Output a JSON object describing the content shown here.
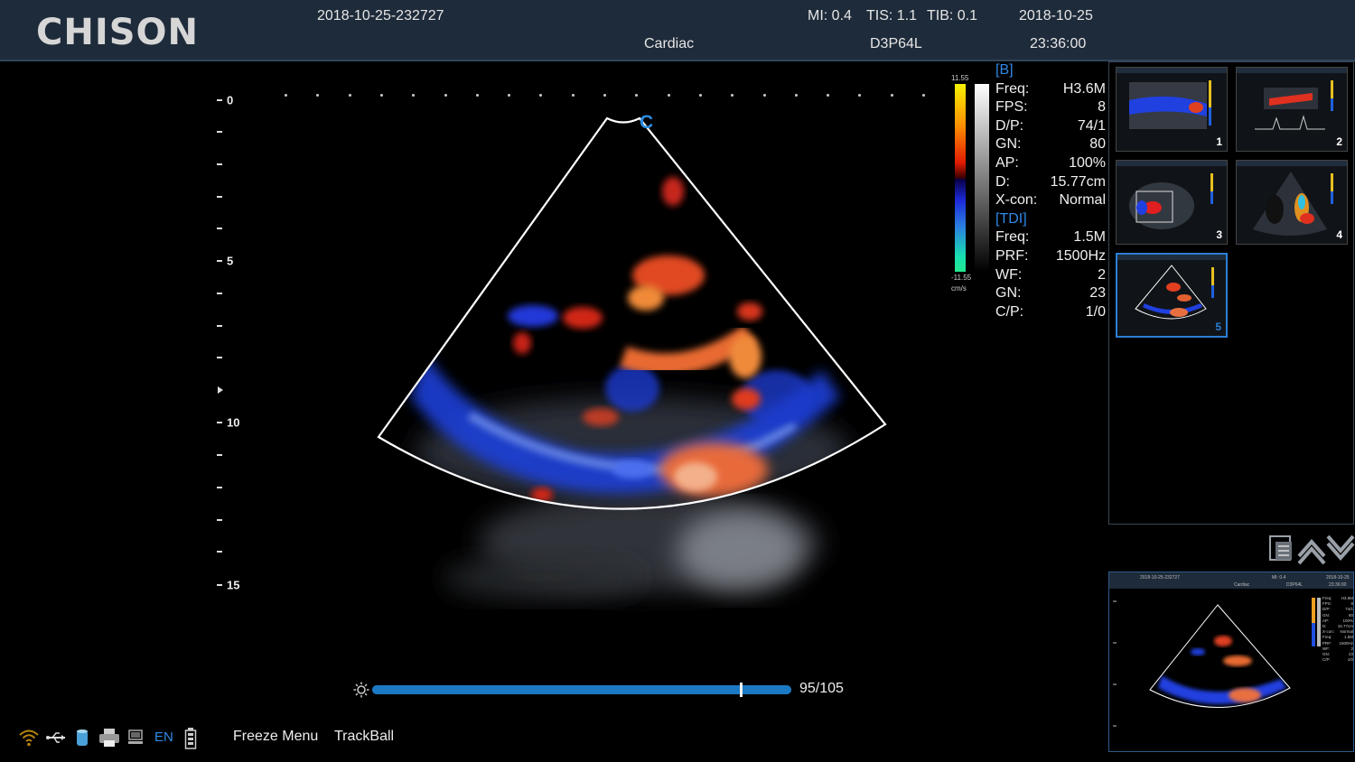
{
  "header": {
    "logo": "CHISON",
    "exam_id": "2018-10-25-232727",
    "preset": "Cardiac",
    "mi": "MI:  0.4",
    "tis": "TIS:  1.1",
    "tib": "TIB:  0.1",
    "probe": "D3P64L",
    "date": "2018-10-25",
    "time": "23:36:00"
  },
  "depth_scale": {
    "labels": [
      "0",
      "5",
      "10",
      "15"
    ]
  },
  "image": {
    "orientation_mark": "C"
  },
  "color_scale": {
    "max": "11.55",
    "min": "-11.55",
    "unit": "cm/s"
  },
  "params": {
    "b_section": "[B]",
    "b": [
      {
        "k": "Freq:",
        "v": "H3.6M"
      },
      {
        "k": "FPS:",
        "v": "8"
      },
      {
        "k": "D/P:",
        "v": "74/1"
      },
      {
        "k": "GN:",
        "v": "80"
      },
      {
        "k": "AP:",
        "v": "100%"
      },
      {
        "k": "D:",
        "v": "15.77cm"
      },
      {
        "k": "X-con:",
        "v": "Normal"
      }
    ],
    "tdi_section": "[TDI]",
    "tdi": [
      {
        "k": "Freq:",
        "v": "1.5M"
      },
      {
        "k": "PRF:",
        "v": "1500Hz"
      },
      {
        "k": "WF:",
        "v": "2"
      },
      {
        "k": "GN:",
        "v": "23"
      },
      {
        "k": "C/P:",
        "v": "1/0"
      }
    ]
  },
  "thumbnails": [
    {
      "num": "1"
    },
    {
      "num": "2"
    },
    {
      "num": "3"
    },
    {
      "num": "4"
    },
    {
      "num": "5",
      "selected": true
    }
  ],
  "cine": {
    "count": "95/105",
    "current": 95,
    "total": 105
  },
  "status": {
    "lang": "EN",
    "freeze_menu": "Freeze Menu",
    "trackball": "TrackBall"
  },
  "colors": {
    "header_bg": "#1e2b3a",
    "accent": "#2f8ae8",
    "cine_fill": "#1c79c4"
  },
  "icons": [
    "wifi-icon",
    "usb-icon",
    "storage-icon",
    "printer-icon",
    "network-icon",
    "battery-icon",
    "brightness-icon",
    "page-list-icon",
    "page-up-icon",
    "page-down-icon"
  ]
}
